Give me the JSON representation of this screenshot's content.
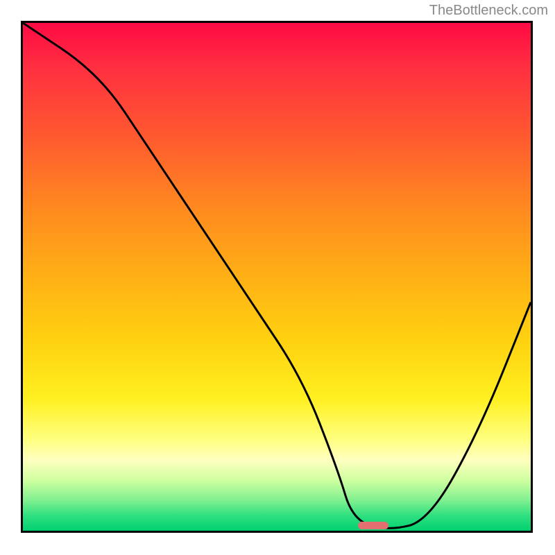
{
  "watermark": "TheBottleneck.com",
  "chart_data": {
    "type": "line",
    "title": "",
    "xlabel": "",
    "ylabel": "",
    "xlim": [
      0,
      100
    ],
    "ylim": [
      0,
      100
    ],
    "series": [
      {
        "name": "curve",
        "x": [
          0,
          15,
          25,
          35,
          45,
          55,
          62,
          65,
          72,
          80,
          90,
          100
        ],
        "values": [
          100,
          90,
          75,
          60,
          45,
          30,
          12,
          2,
          0,
          2,
          20,
          45
        ]
      }
    ],
    "marker": {
      "x": 69,
      "y": 1,
      "width": 6,
      "height": 1.5
    },
    "gradient_stops": [
      {
        "pct": 0,
        "color": "#ff0a44"
      },
      {
        "pct": 22,
        "color": "#ff5830"
      },
      {
        "pct": 50,
        "color": "#ffb015"
      },
      {
        "pct": 74,
        "color": "#fff020"
      },
      {
        "pct": 90,
        "color": "#d0ffa0"
      },
      {
        "pct": 100,
        "color": "#00d070"
      }
    ]
  }
}
